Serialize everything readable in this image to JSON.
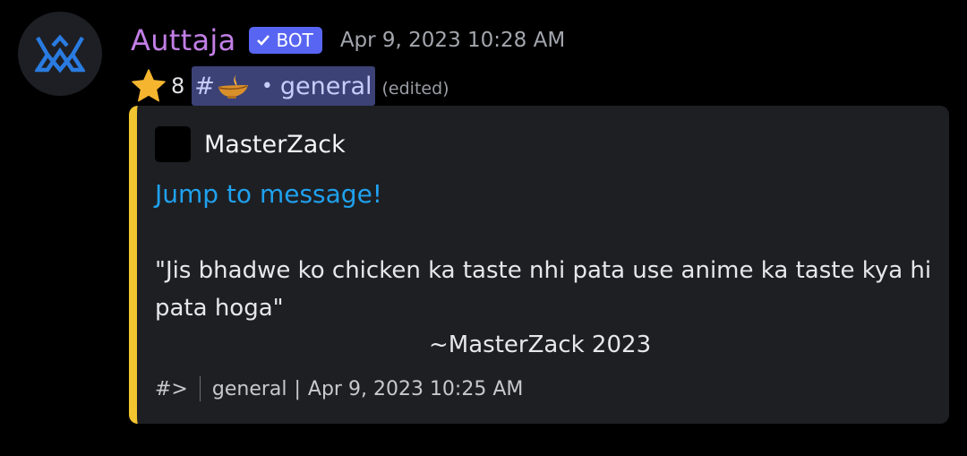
{
  "message": {
    "author": {
      "name": "Auttaja",
      "bot_tag": "BOT",
      "avatar_icon": "crown-logo-icon",
      "name_color": "#c27fe6"
    },
    "timestamp": "Apr 9, 2023 10:28 AM",
    "star_count": "8",
    "channel": {
      "hash": "#",
      "emoji_icon": "oil-lamp-icon",
      "separator": "•",
      "name": "general"
    },
    "edited_label": "(edited)"
  },
  "embed": {
    "accent_color": "#f2c42f",
    "author_name": "MasterZack",
    "jump_link": "Jump to message!",
    "quote": "\"Jis bhadwe ko chicken ka taste nhi pata use anime ka taste kya hi pata hoga\"",
    "signature": "~MasterZack 2023",
    "footer": {
      "channel_icon": "#>",
      "channel_name": "general",
      "separator": "|",
      "timestamp": "Apr 9, 2023 10:25 AM"
    }
  }
}
